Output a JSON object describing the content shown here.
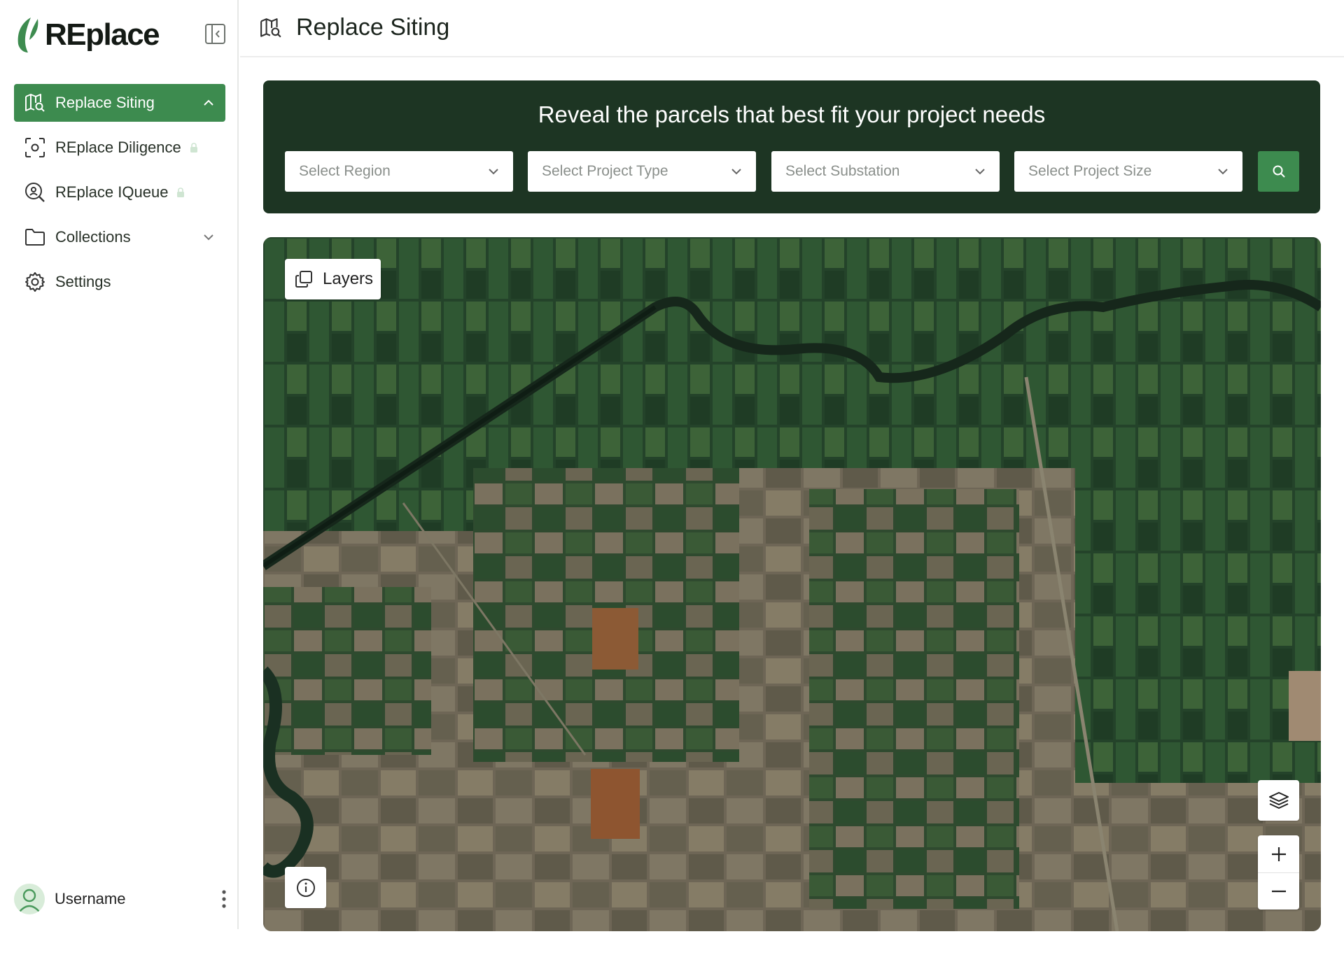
{
  "app": {
    "brand": "REplace"
  },
  "sidebar": {
    "items": [
      {
        "label": "Replace Siting",
        "icon": "map-search-icon",
        "active": true
      },
      {
        "label": "REplace Diligence",
        "icon": "scan-target-icon",
        "locked": true
      },
      {
        "label": "REplace IQueue",
        "icon": "search-location-icon",
        "locked": true
      },
      {
        "label": "Collections",
        "icon": "folder-icon",
        "expandable": true
      },
      {
        "label": "Settings",
        "icon": "gear-icon"
      }
    ],
    "user": {
      "name": "Username"
    }
  },
  "header": {
    "title": "Replace Siting"
  },
  "search": {
    "heading": "Reveal the parcels that best fit your project needs",
    "selects": [
      {
        "placeholder": "Select Region"
      },
      {
        "placeholder": "Select Project Type"
      },
      {
        "placeholder": "Select Substation"
      },
      {
        "placeholder": "Select Project Size"
      }
    ]
  },
  "map": {
    "layers_label": "Layers",
    "colors": {
      "accent": "#3d8b4f",
      "panel": "#1d3523"
    }
  }
}
